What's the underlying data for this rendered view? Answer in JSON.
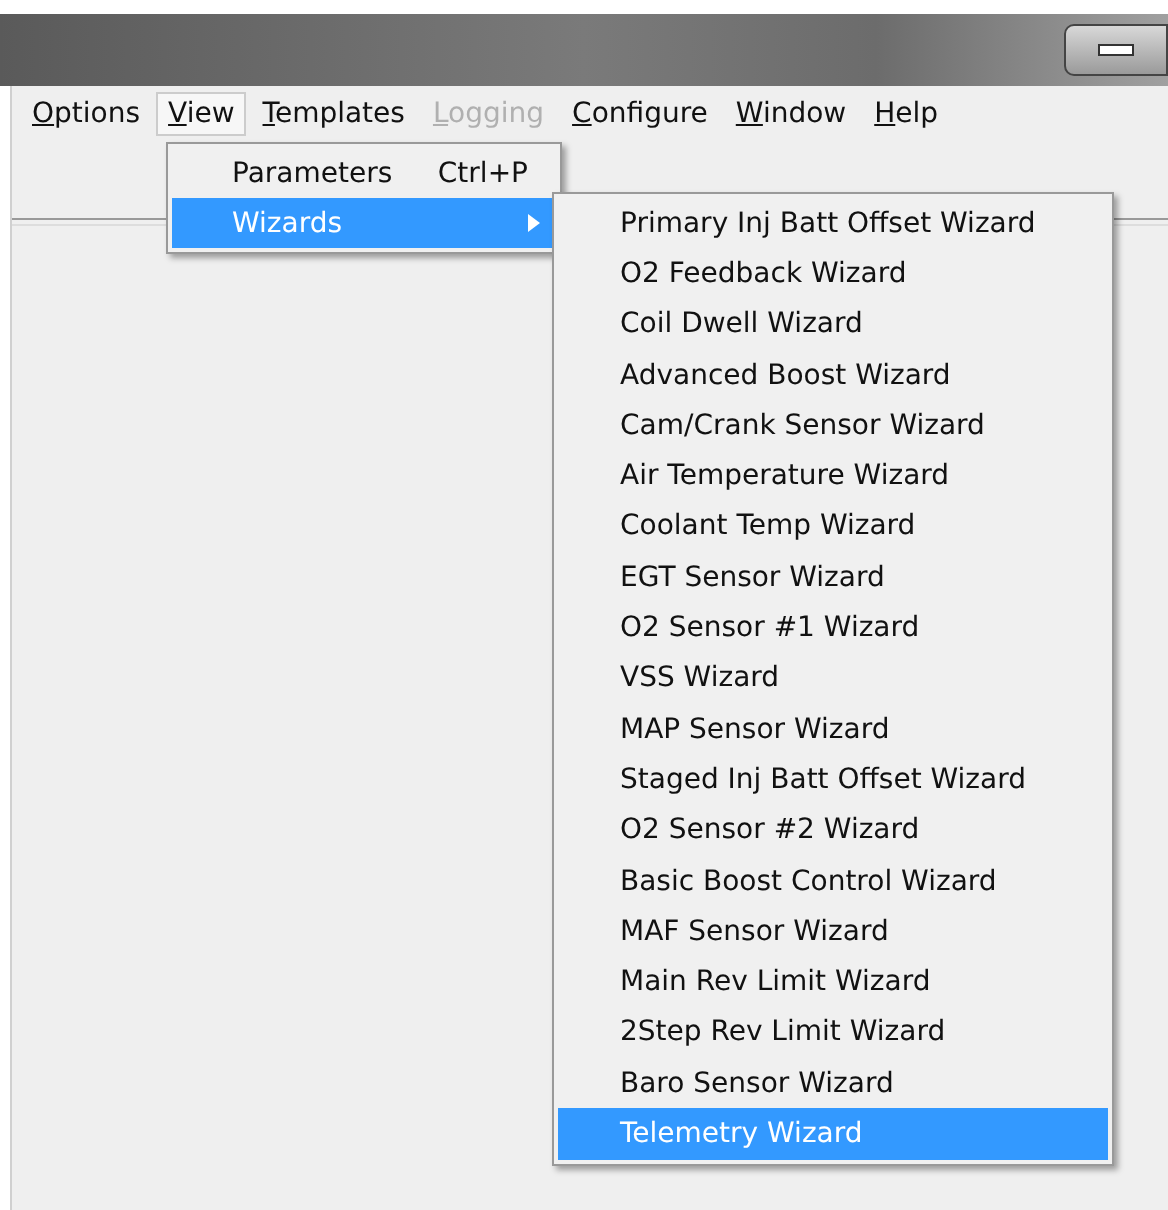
{
  "menubar": [
    {
      "label": "Options",
      "disabled": false,
      "selected": false
    },
    {
      "label": "View",
      "disabled": false,
      "selected": true
    },
    {
      "label": "Templates",
      "disabled": false,
      "selected": false
    },
    {
      "label": "Logging",
      "disabled": true,
      "selected": false
    },
    {
      "label": "Configure",
      "disabled": false,
      "selected": false
    },
    {
      "label": "Window",
      "disabled": false,
      "selected": false
    },
    {
      "label": "Help",
      "disabled": false,
      "selected": false
    }
  ],
  "view_menu": [
    {
      "label": "Parameters",
      "shortcut": "Ctrl+P",
      "selected": false,
      "submenu": false
    },
    {
      "label": "Wizards",
      "selected": true,
      "submenu": true
    }
  ],
  "wizards_menu": [
    {
      "label": "Primary Inj Batt Offset Wizard",
      "selected": false
    },
    {
      "label": "O2 Feedback Wizard",
      "selected": false
    },
    {
      "label": "Coil Dwell Wizard",
      "selected": false
    },
    {
      "label": "Advanced Boost Wizard",
      "selected": false
    },
    {
      "label": "Cam/Crank Sensor Wizard",
      "selected": false
    },
    {
      "label": "Air Temperature Wizard",
      "selected": false
    },
    {
      "label": "Coolant Temp Wizard",
      "selected": false
    },
    {
      "label": "EGT Sensor Wizard",
      "selected": false
    },
    {
      "label": "O2 Sensor #1 Wizard",
      "selected": false
    },
    {
      "label": "VSS Wizard",
      "selected": false
    },
    {
      "label": "MAP Sensor Wizard",
      "selected": false
    },
    {
      "label": "Staged Inj Batt Offset Wizard",
      "selected": false
    },
    {
      "label": "O2 Sensor #2 Wizard",
      "selected": false
    },
    {
      "label": "Basic Boost Control Wizard",
      "selected": false
    },
    {
      "label": "MAF Sensor Wizard",
      "selected": false
    },
    {
      "label": "Main Rev Limit Wizard",
      "selected": false
    },
    {
      "label": "2Step Rev Limit Wizard",
      "selected": false
    },
    {
      "label": "Baro Sensor Wizard",
      "selected": false
    },
    {
      "label": "Telemetry Wizard",
      "selected": true
    }
  ]
}
